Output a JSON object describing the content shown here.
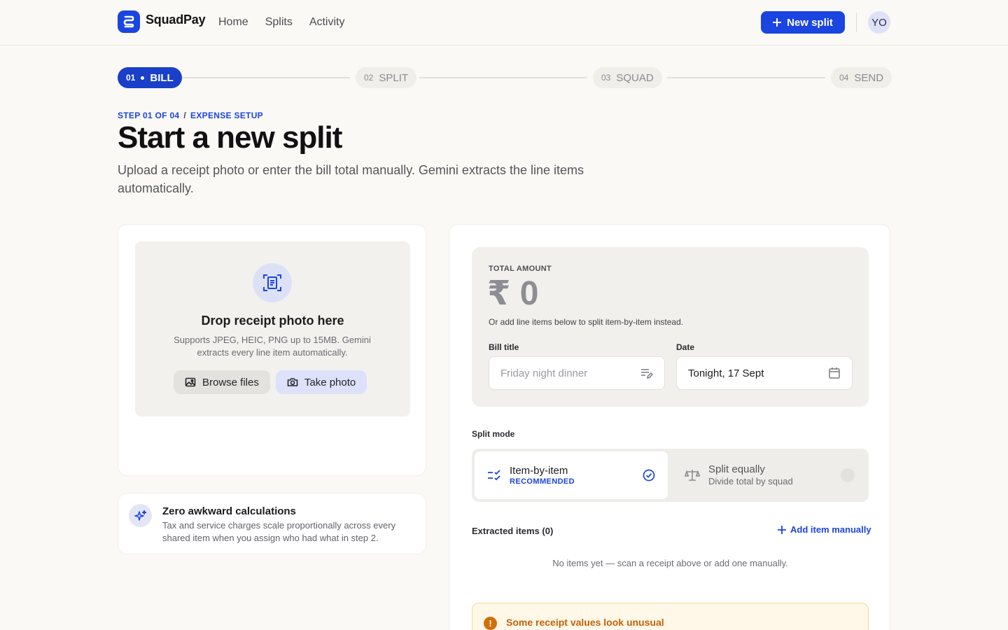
{
  "app": {
    "name": "SquadPay"
  },
  "nav": {
    "items": [
      "Home",
      "Splits",
      "Activity"
    ]
  },
  "header": {
    "new_split_label": "New split",
    "avatar_initials": "YO"
  },
  "stepper": {
    "steps": [
      {
        "num": "01",
        "label": "BILL",
        "state": "active"
      },
      {
        "num": "02",
        "label": "SPLIT",
        "state": "inactive"
      },
      {
        "num": "03",
        "label": "SQUAD",
        "state": "inactive"
      },
      {
        "num": "04",
        "label": "SEND",
        "state": "inactive"
      }
    ]
  },
  "page": {
    "crumb_step": "STEP 01 OF 04",
    "crumb_sep": "/",
    "crumb_section": "EXPENSE SETUP",
    "title": "Start a new split",
    "subtitle": "Upload a receipt photo or enter the bill total manually. Gemini extracts the line items automatically."
  },
  "upload": {
    "title": "Drop receipt photo here",
    "subtitle": "Supports JPEG, HEIC, PNG up to 15MB. Gemini extracts every line item automatically.",
    "browse_label": "Browse files",
    "photo_label": "Take photo"
  },
  "tip": {
    "title": "Zero awkward calculations",
    "text": "Tax and service charges scale proportionally across every shared item when you assign who had what in step 2."
  },
  "total": {
    "label": "TOTAL AMOUNT",
    "value": "₹ 0",
    "hint": "Or add line items below to split item-by-item instead."
  },
  "bill": {
    "title_label": "Bill title",
    "title_placeholder": "Friday night dinner",
    "date_label": "Date",
    "date_value": "Tonight, 17 Sept"
  },
  "split_mode": {
    "label": "Split mode",
    "item_title": "Item-by-item",
    "item_badge": "RECOMMENDED",
    "equal_title": "Split equally",
    "equal_sub": "Divide total by squad",
    "selected": "Item-by-item"
  },
  "items": {
    "label": "Extracted items (0)",
    "add_label": "Add item manually",
    "empty_text": "No items yet — scan a receipt above or add one manually."
  },
  "warning": {
    "text": "Some receipt values look unusual"
  },
  "colors": {
    "accent": "#1a45e0",
    "warning": "#c2620a",
    "background": "#faf9f5"
  }
}
